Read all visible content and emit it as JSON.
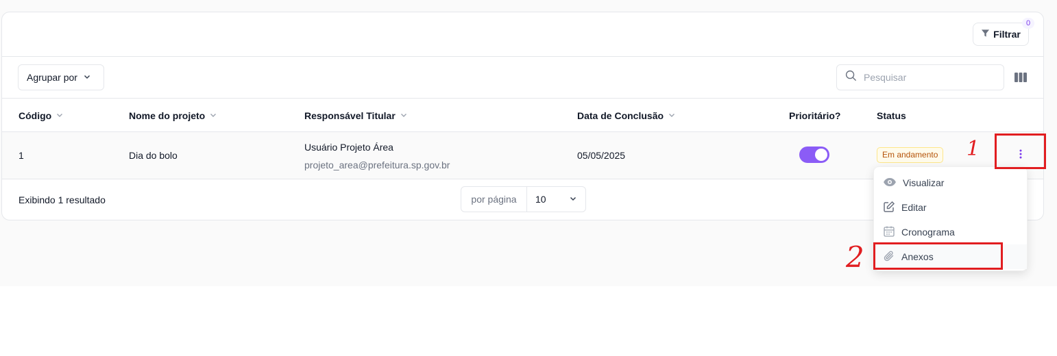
{
  "filter": {
    "label": "Filtrar",
    "count": "0"
  },
  "toolbar": {
    "group_label": "Agrupar por",
    "search_placeholder": "Pesquisar"
  },
  "table": {
    "headers": [
      "Código",
      "Nome do projeto",
      "Responsável Titular",
      "Data de Conclusão",
      "Prioritário?",
      "Status"
    ],
    "rows": [
      {
        "code": "1",
        "name": "Dia do bolo",
        "owner_name": "Usuário Projeto Área",
        "owner_email": "projeto_area@prefeitura.sp.gov.br",
        "date": "05/05/2025",
        "priority": true,
        "status": "Em andamento"
      }
    ]
  },
  "footer": {
    "result_text": "Exibindo 1 resultado",
    "per_page_label": "por página",
    "per_page_value": "10"
  },
  "row_menu": {
    "items": [
      {
        "label": "Visualizar",
        "icon": "eye-icon"
      },
      {
        "label": "Editar",
        "icon": "edit-icon"
      },
      {
        "label": "Cronograma",
        "icon": "calendar-icon"
      },
      {
        "label": "Anexos",
        "icon": "paperclip-icon"
      }
    ]
  },
  "annotations": {
    "step1": "1",
    "step2": "2"
  },
  "colors": {
    "accent": "#8b5cf6",
    "highlight": "#e11d20",
    "status_bg": "#fffbeb",
    "status_text": "#b45309"
  }
}
